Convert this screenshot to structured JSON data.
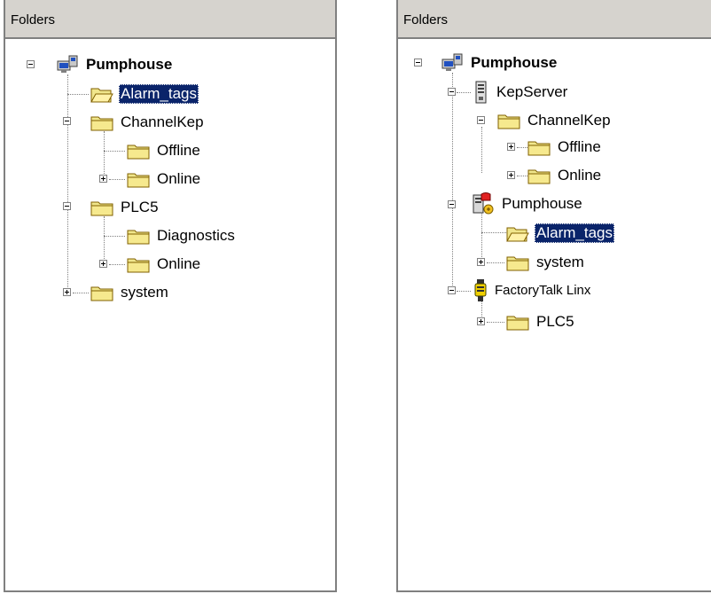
{
  "left_panel": {
    "header": "Folders",
    "nodes": [
      {
        "label": "Pumphouse"
      },
      {
        "label": "Alarm_tags"
      },
      {
        "label": "ChannelKep"
      },
      {
        "label": "Offline"
      },
      {
        "label": "Online"
      },
      {
        "label": "PLC5"
      },
      {
        "label": "Diagnostics"
      },
      {
        "label": "Online"
      },
      {
        "label": "system"
      }
    ]
  },
  "right_panel": {
    "header": "Folders",
    "nodes": [
      {
        "label": "Pumphouse"
      },
      {
        "label": "KepServer"
      },
      {
        "label": "ChannelKep"
      },
      {
        "label": "Offline"
      },
      {
        "label": "Online"
      },
      {
        "label": "Pumphouse"
      },
      {
        "label": "Alarm_tags"
      },
      {
        "label": "system"
      },
      {
        "label": "FactoryTalk Linx"
      },
      {
        "label": "PLC5"
      }
    ]
  },
  "colors": {
    "header_bg": "#d6d3ce",
    "selection_bg": "#0a246a",
    "folder_fill": "#f0e68c"
  }
}
